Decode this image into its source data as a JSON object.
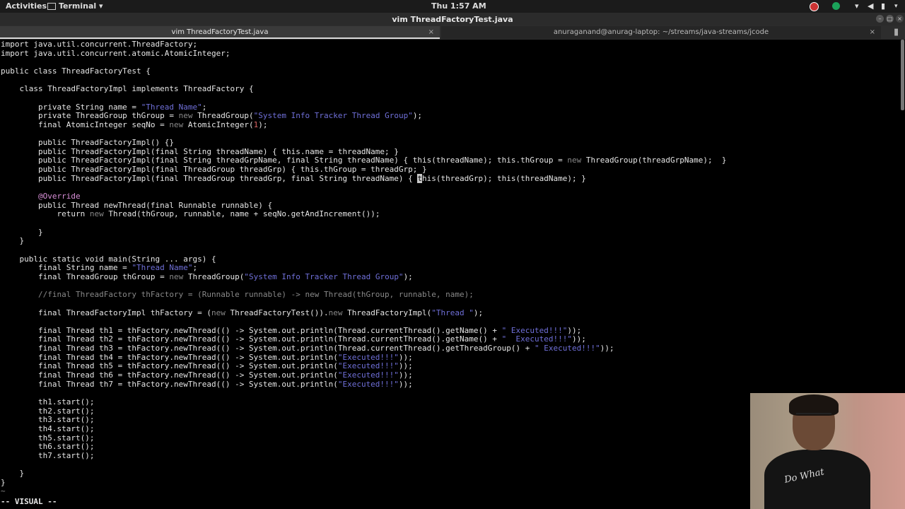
{
  "topbar": {
    "activities": "Activities",
    "app_menu": "Terminal ▾",
    "clock": "Thu  1:57 AM"
  },
  "window": {
    "title": "vim ThreadFactoryTest.java"
  },
  "tabs": [
    {
      "label": "vim ThreadFactoryTest.java",
      "close": "×"
    },
    {
      "label": "anuraganand@anurag-laptop: ~/streams/java-streams/jcode",
      "close": "×"
    }
  ],
  "editor": {
    "lines": [
      "import java.util.concurrent.ThreadFactory;",
      "import java.util.concurrent.atomic.AtomicInteger;",
      "",
      "public class ThreadFactoryTest {",
      "",
      "    class ThreadFactoryImpl implements ThreadFactory {",
      "",
      "        private String name = \"Thread Name\";",
      "        private ThreadGroup thGroup = new ThreadGroup(\"System Info Tracker Thread Group\");",
      "        final AtomicInteger seqNo = new AtomicInteger(1);",
      "",
      "        public ThreadFactoryImpl() {}",
      "        public ThreadFactoryImpl(final String threadName) { this.name = threadName; }",
      "        public ThreadFactoryImpl(final String threadGrpName, final String threadName) { this(threadName); this.thGroup = new ThreadGroup(threadGrpName);  }",
      "        public ThreadFactoryImpl(final ThreadGroup threadGrp) { this.thGroup = threadGrp; }",
      "        public ThreadFactoryImpl(final ThreadGroup threadGrp, final String threadName) { this(threadGrp); this(threadName); }",
      "",
      "        @Override",
      "        public Thread newThread(final Runnable runnable) {",
      "            return new Thread(thGroup, runnable, name + seqNo.getAndIncrement());",
      "",
      "        }",
      "    }",
      "",
      "    public static void main(String ... args) {",
      "        final String name = \"Thread Name\";",
      "        final ThreadGroup thGroup = new ThreadGroup(\"System Info Tracker Thread Group\");",
      "",
      "        //final ThreadFactory thFactory = (Runnable runnable) -> new Thread(thGroup, runnable, name);",
      "",
      "        final ThreadFactoryImpl thFactory = (new ThreadFactoryTest()).new ThreadFactoryImpl(\"Thread \");",
      "",
      "        final Thread th1 = thFactory.newThread(() -> System.out.println(Thread.currentThread().getName() + \" Executed!!!\"));",
      "        final Thread th2 = thFactory.newThread(() -> System.out.println(Thread.currentThread().getName() + \"  Executed!!!\"));",
      "        final Thread th3 = thFactory.newThread(() -> System.out.println(Thread.currentThread().getThreadGroup() + \" Executed!!!\"));",
      "        final Thread th4 = thFactory.newThread(() -> System.out.println(\"Executed!!!\"));",
      "        final Thread th5 = thFactory.newThread(() -> System.out.println(\"Executed!!!\"));",
      "        final Thread th6 = thFactory.newThread(() -> System.out.println(\"Executed!!!\"));",
      "        final Thread th7 = thFactory.newThread(() -> System.out.println(\"Executed!!!\"));",
      "",
      "        th1.start();",
      "        th2.start();",
      "        th3.start();",
      "        th4.start();",
      "        th5.start();",
      "        th6.start();",
      "        th7.start();",
      "",
      "    }",
      "}"
    ],
    "tilde": "~",
    "mode": "-- VISUAL --"
  },
  "webcam": {
    "shirt_text": "Do What"
  }
}
